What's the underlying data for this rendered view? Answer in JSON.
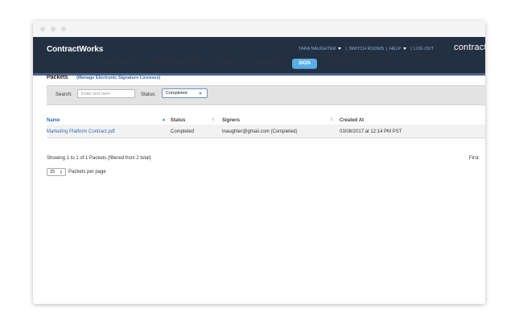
{
  "app": {
    "logo": "ContractWorks",
    "brand_right": "contract"
  },
  "topnav": {
    "user": "TARA NAUGHTER",
    "switch_rooms": "SWITCH ROOMS",
    "help": "HELP",
    "logout": "LOG OUT"
  },
  "mainnav": [
    "DOCUMENTS",
    "TAGS / TEMPLATES",
    "USERS",
    "REPORTS",
    "SIGN",
    "SETTINGS"
  ],
  "page": {
    "title": "Packets",
    "manage_link": "(Manage Electronic Signature Licenses)"
  },
  "filter": {
    "search_label": "Search:",
    "search_placeholder": "Enter text here",
    "status_label": "Status:",
    "status_value": "Completed"
  },
  "table": {
    "headers": [
      "Name",
      "Status",
      "Signers",
      "Created At"
    ],
    "rows": [
      {
        "name": "Marketing Platform Contract.pdf",
        "status": "Completed",
        "signers": "tnaughter@gmail.com (Completed)",
        "created_at": "03/08/2017 at 12:14 PM PST"
      }
    ]
  },
  "footer": {
    "showing": "Showing 1 to 1 of 1 Packets (filtered from 2 total)",
    "first": "First",
    "per_page_value": "25",
    "per_page_label": "Packets per page"
  },
  "colors": {
    "topbar": "#233042",
    "accent": "#5aaee4",
    "link": "#2f6db5"
  }
}
